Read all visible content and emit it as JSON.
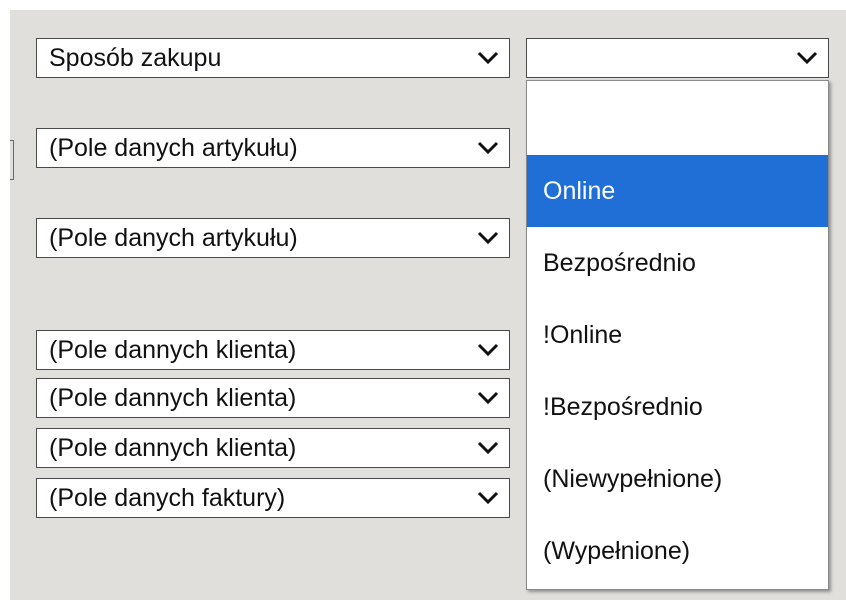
{
  "filters": {
    "rows": [
      {
        "label": "Sposób zakupu"
      },
      {
        "label": "(Pole danych artykułu)"
      },
      {
        "label": "(Pole danych artykułu)"
      },
      {
        "label": "(Pole dannych klienta)"
      },
      {
        "label": "(Pole dannych klienta)"
      },
      {
        "label": "(Pole dannych klienta)"
      },
      {
        "label": "(Pole danych faktury)"
      }
    ]
  },
  "value_select": {
    "current_value": ""
  },
  "dropdown": {
    "options": [
      {
        "label": ""
      },
      {
        "label": "Online"
      },
      {
        "label": "Bezpośrednio"
      },
      {
        "label": "!Online"
      },
      {
        "label": "!Bezpośrednio"
      },
      {
        "label": "(Niewypełnione)"
      },
      {
        "label": "(Wypełnione)"
      }
    ],
    "highlighted": "Online",
    "highlight_color": "#1f6fd6"
  }
}
